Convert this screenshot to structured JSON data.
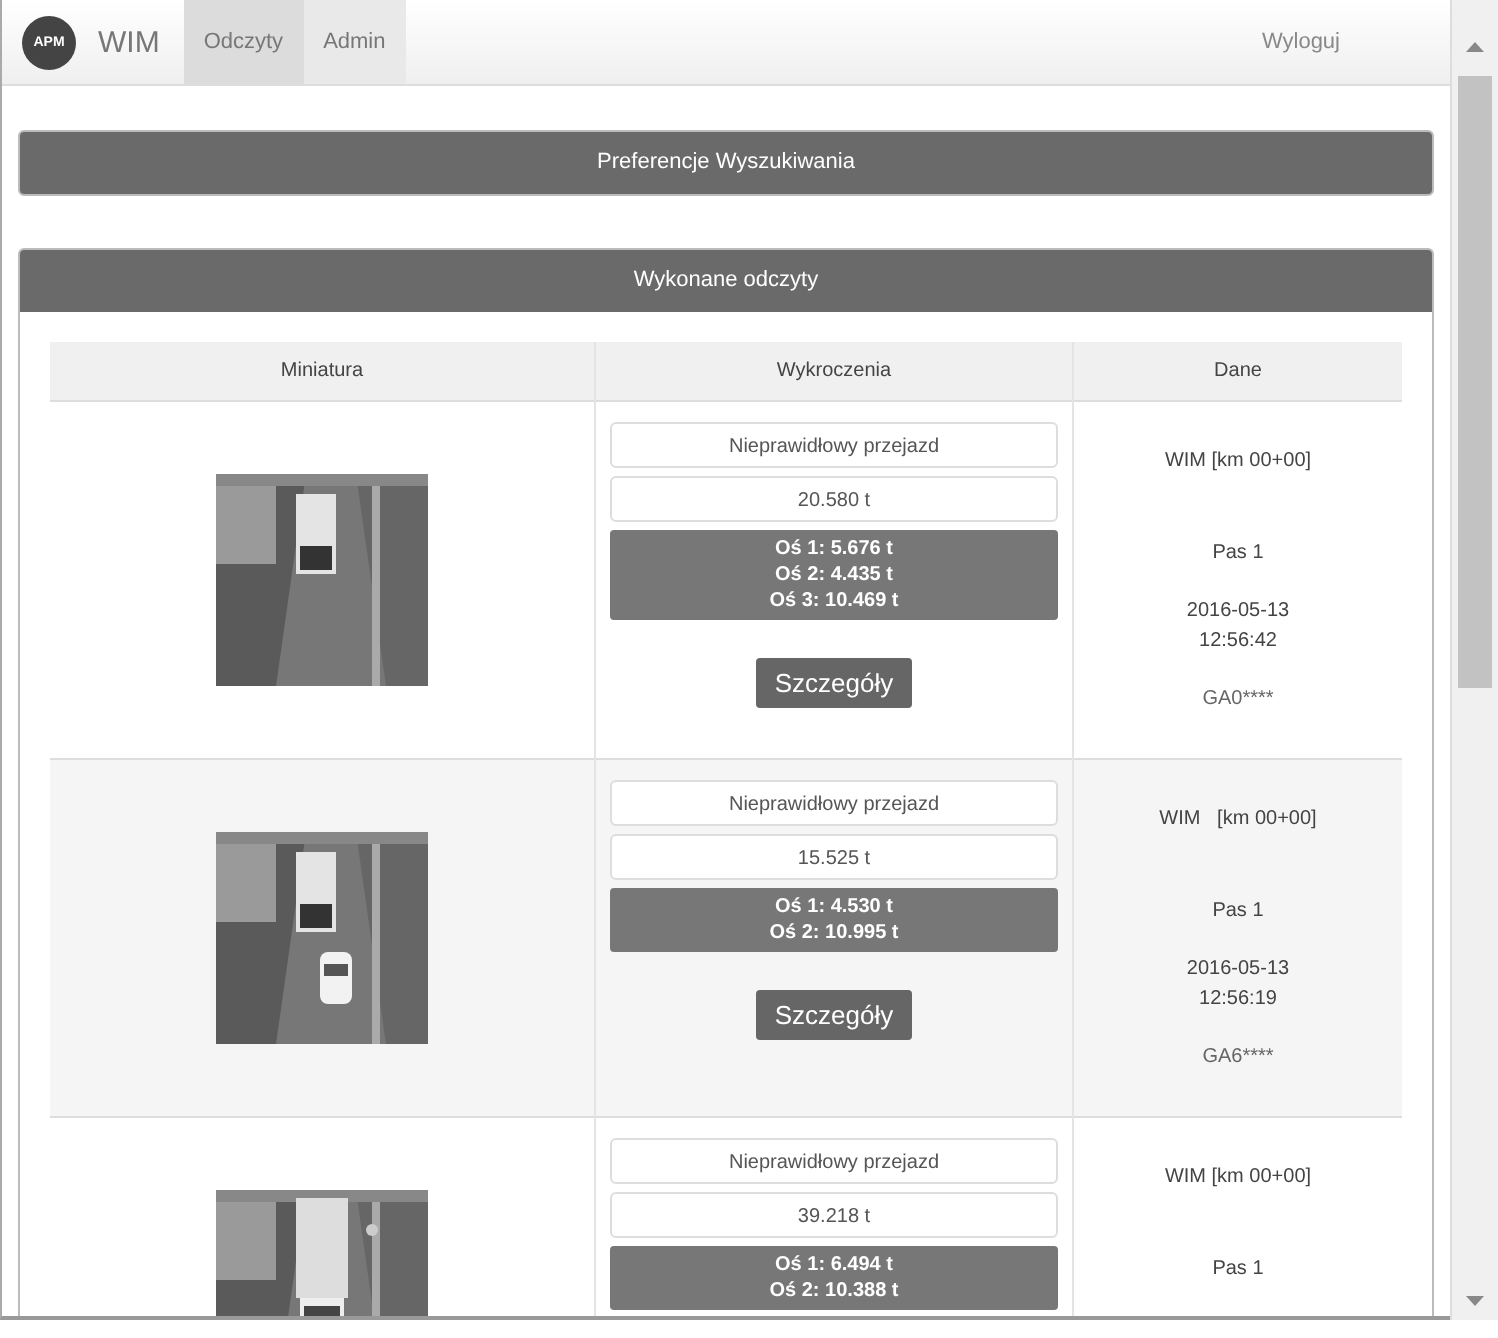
{
  "navbar": {
    "logo": "APM",
    "brand": "WIM",
    "tabs": [
      {
        "label": "Odczyty",
        "selected": true
      },
      {
        "label": "Admin",
        "selected": false
      }
    ],
    "logout": "Wyloguj"
  },
  "search_panel": {
    "title": "Preferencje Wyszukiwania"
  },
  "readings_panel": {
    "title": "Wykonane odczyty",
    "table": {
      "columns": [
        "Miniatura",
        "Wykroczenia",
        "Dane"
      ],
      "rows": [
        {
          "thumbnail": {
            "kind": "picture"
          },
          "violation": "Nieprawidłowy przejazd",
          "total": "20.580 t",
          "axles": [
            "Oś 1: 5.676 t",
            "Oś 2: 4.435 t",
            "Oś 3: 10.469 t"
          ],
          "button": "Szczegóły",
          "location": "WIM [km 00+00]",
          "lane": "Pas 1",
          "date": "2016-05-13",
          "time": "12:56:42",
          "plate": "GA0****"
        },
        {
          "thumbnail": {
            "kind": "picture"
          },
          "violation": "Nieprawidłowy przejazd",
          "total": "15.525 t",
          "axles": [
            "Oś 1: 4.530 t",
            "Oś 2: 10.995 t"
          ],
          "button": "Szczegóły",
          "location": "WIM   [km 00+00]",
          "lane": "Pas 1",
          "date": "2016-05-13",
          "time": "12:56:19",
          "plate": "GA6****"
        },
        {
          "thumbnail": {
            "kind": "picture"
          },
          "violation": "Nieprawidłowy przejazd",
          "total": "39.218 t",
          "axles": [
            "Oś 1: 6.494 t",
            "Oś 2: 10.388 t"
          ],
          "location": "WIM [km 00+00]",
          "lane": "Pas 1"
        }
      ]
    }
  }
}
